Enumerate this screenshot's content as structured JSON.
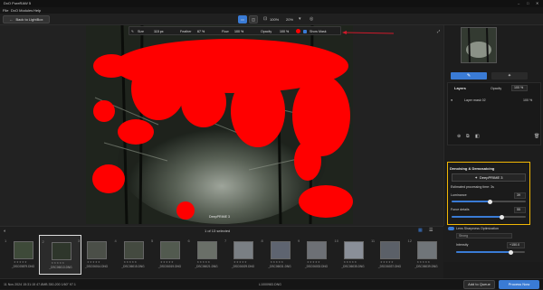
{
  "app": {
    "title": "DxO PureRAW 5"
  },
  "menu": [
    "File",
    "DxO Modules",
    "Help"
  ],
  "toolbar": {
    "back_label": "Back to LightBox",
    "zoom": "100%",
    "zoom2": "20%"
  },
  "hud": {
    "size_label": "Size",
    "size_value": "115 px",
    "feather_label": "Feather",
    "feather_value": "67 %",
    "flow_label": "Flow",
    "flow_value": "100 %",
    "opacity_label": "Opacity",
    "opacity_value": "100 %",
    "showmask_label": "Show Mask"
  },
  "photo": {
    "caption": "DeepPRIME 3"
  },
  "layers": {
    "title": "Layers",
    "opacity_label": "Opacity",
    "opacity_value": "100 %",
    "item_label": "Layer mask 02",
    "item_value": "100 %"
  },
  "denoise": {
    "title": "Denoising & Demosaicing",
    "method": "DeepPRIME 3",
    "estimate": "Estimated processing time: 3s",
    "luminance_label": "Luminance",
    "luminance_value": "39",
    "luminance_fraction": 0.52,
    "force_label": "Force details",
    "force_value": "55",
    "force_fraction": 0.68
  },
  "optical": {
    "title": "Optical Corrections",
    "lens_label": "Lens Sharpness Optimization",
    "select_value": "Strong",
    "intensity_label": "Intensity",
    "intensity_value": "+150.0",
    "intensity_fraction": 0.8
  },
  "strip": {
    "count": "1 of 13 selected",
    "items": [
      {
        "num": "1",
        "file": "_DSC05879.DNG"
      },
      {
        "num": "2",
        "file": "_DSC06013.DNG"
      },
      {
        "num": "3",
        "file": "_DSC06014.DNG"
      },
      {
        "num": "4",
        "file": "_DSC06015.DNG"
      },
      {
        "num": "5",
        "file": "_DSC06019.DNG"
      },
      {
        "num": "6",
        "file": "_DSC06021.DNG"
      },
      {
        "num": "7",
        "file": "_DSC06029.DNG"
      },
      {
        "num": "8",
        "file": "_DSC06031.DNG"
      },
      {
        "num": "9",
        "file": "_DSC06033.DNG"
      },
      {
        "num": "10",
        "file": "_DSC06035.DNG"
      },
      {
        "num": "11",
        "file": "_DSC06037.DNG"
      },
      {
        "num": "12",
        "file": "_DSC06039.DNG"
      }
    ]
  },
  "status": {
    "info": "11 Nov 2024 15:31:15   47.8MB   350-200   1/60\"   f/7.1",
    "center": "L1000983.DNG",
    "queue_label": "Add to Queue",
    "process_label": "Process Now"
  },
  "colors": {
    "accent": "#3a7bd5",
    "mask": "#ff0000",
    "highlight": "#f2b705"
  }
}
